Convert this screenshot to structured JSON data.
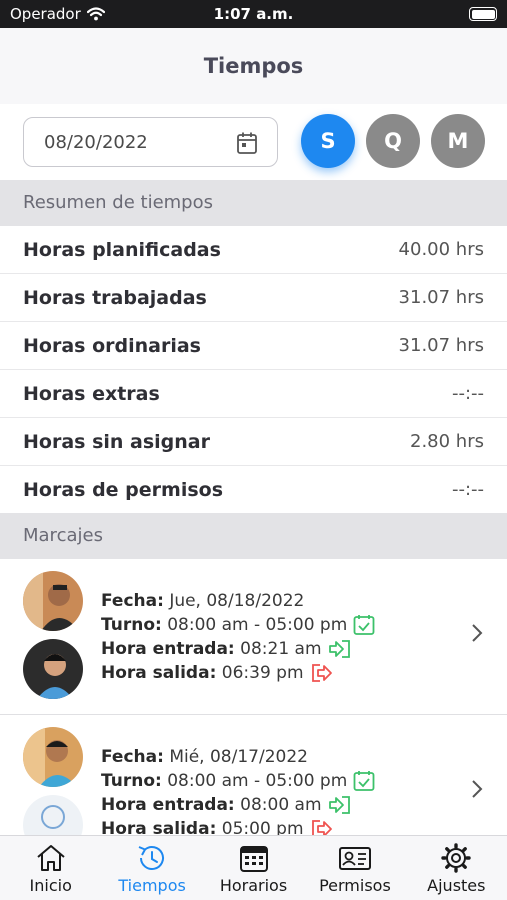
{
  "status_bar": {
    "carrier": "Operador",
    "time": "1:07 a.m."
  },
  "header": {
    "title": "Tiempos"
  },
  "filter": {
    "date": "08/20/2022",
    "period_buttons": [
      "S",
      "Q",
      "M"
    ],
    "selected_period": "S"
  },
  "summary": {
    "title": "Resumen de tiempos",
    "rows": [
      {
        "label": "Horas planificadas",
        "value": "40.00 hrs"
      },
      {
        "label": "Horas trabajadas",
        "value": "31.07 hrs"
      },
      {
        "label": "Horas ordinarias",
        "value": "31.07 hrs"
      },
      {
        "label": "Horas extras",
        "value": "--:--"
      },
      {
        "label": "Horas sin asignar",
        "value": "2.80 hrs"
      },
      {
        "label": "Horas de permisos",
        "value": "--:--"
      }
    ]
  },
  "marcajes": {
    "title": "Marcajes",
    "labels": {
      "fecha": "Fecha:",
      "turno": "Turno:",
      "entrada": "Hora entrada:",
      "salida": "Hora salida:"
    },
    "items": [
      {
        "fecha": "Jue, 08/18/2022",
        "turno": "08:00 am - 05:00 pm",
        "entrada": "08:21 am",
        "salida": "06:39 pm"
      },
      {
        "fecha": "Mié, 08/17/2022",
        "turno": "08:00 am - 05:00 pm",
        "entrada": "08:00 am",
        "salida": "05:00 pm"
      }
    ]
  },
  "tabs": [
    {
      "label": "Inicio",
      "icon": "home-icon"
    },
    {
      "label": "Tiempos",
      "icon": "history-icon"
    },
    {
      "label": "Horarios",
      "icon": "calendar-icon"
    },
    {
      "label": "Permisos",
      "icon": "id-card-icon"
    },
    {
      "label": "Ajustes",
      "icon": "gear-icon"
    }
  ],
  "colors": {
    "accent": "#1e88f0",
    "inactive_period": "#8a8a8a",
    "entry_icon": "#3cc16a",
    "exit_icon": "#ef5350",
    "section_header_bg": "#e3e3e6"
  }
}
